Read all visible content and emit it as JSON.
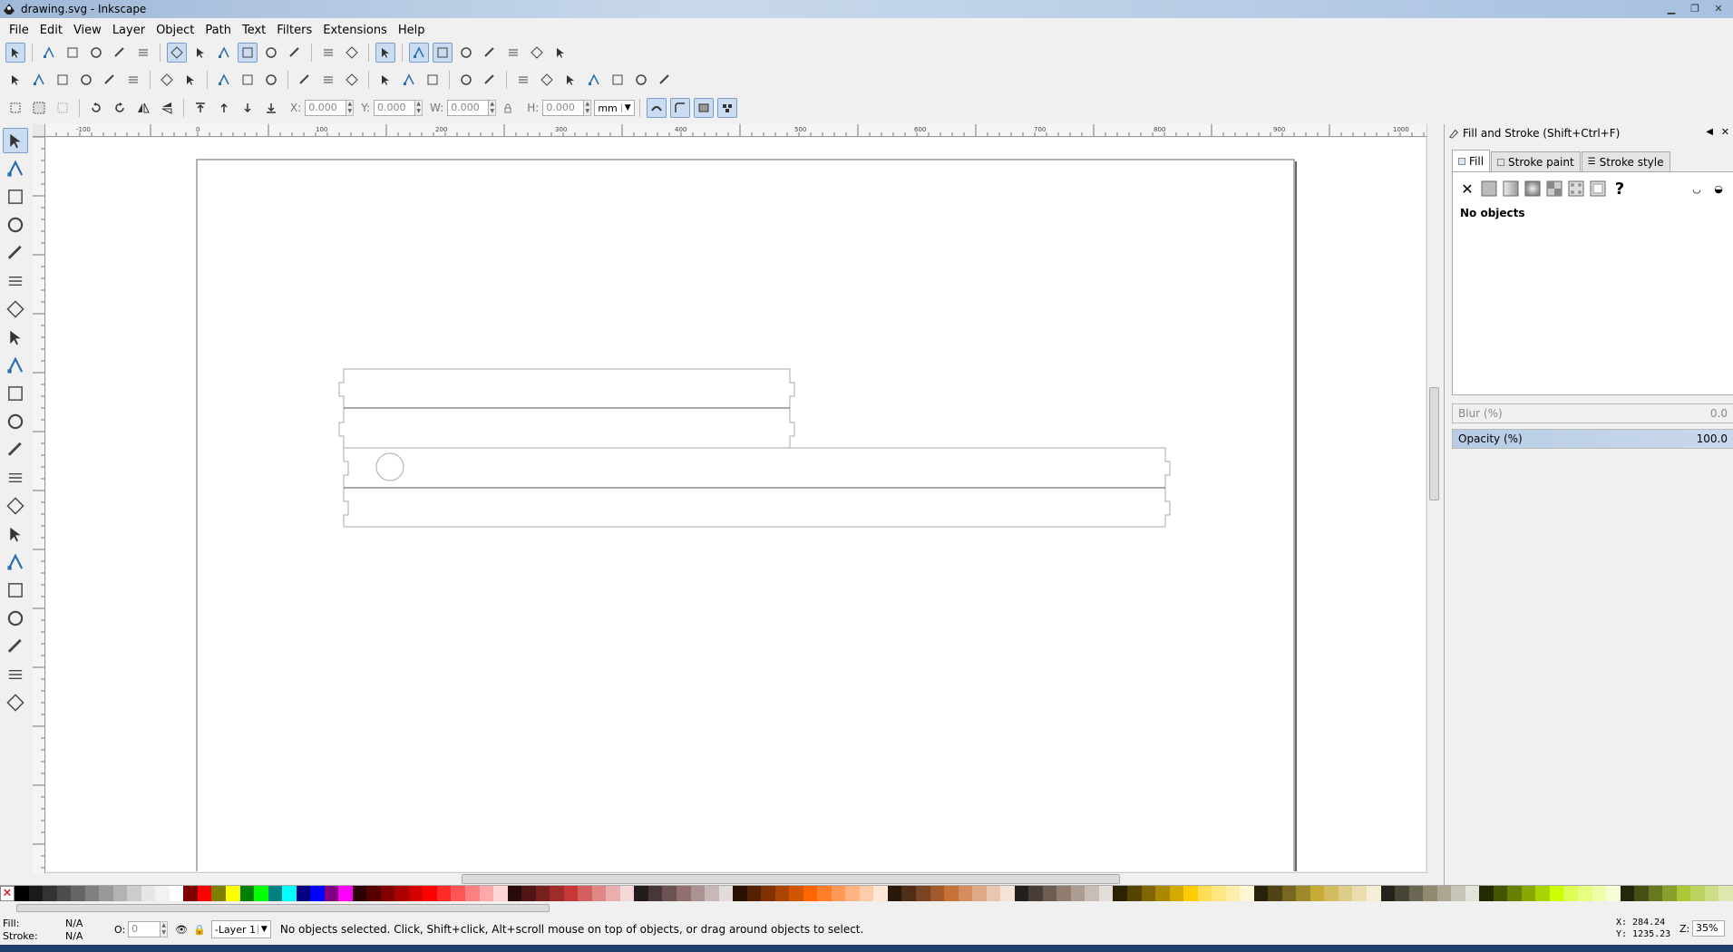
{
  "window": {
    "title": "drawing.svg - Inkscape"
  },
  "menu": [
    "File",
    "Edit",
    "View",
    "Layer",
    "Object",
    "Path",
    "Text",
    "Filters",
    "Extensions",
    "Help"
  ],
  "node_toolbar": {
    "icons": [
      "node-edit-icon",
      "add-node-icon",
      "delete-node-icon",
      "join-nodes-icon",
      "break-path-icon",
      "join-segment-icon",
      "delete-segment-icon",
      "make-cusp-icon",
      "make-smooth-icon",
      "make-symmetric-icon",
      "auto-smooth-icon",
      "line-segment-icon",
      "curve-segment-icon",
      "show-handles-icon",
      "show-outline-icon",
      "snap-nodes-icon",
      "snap-midpoints-icon",
      "snap-center-icon",
      "text-snap-icon",
      "page-snap-icon",
      "grid-snap-icon",
      "guide-snap-icon"
    ]
  },
  "command_bar": {
    "icons": [
      "new-icon",
      "open-icon",
      "save-icon",
      "print-icon",
      "import-icon",
      "export-icon",
      "undo-icon",
      "redo-icon",
      "copy-icon",
      "cut-icon",
      "paste-icon",
      "zoom-drawing-icon",
      "zoom-page-icon",
      "zoom-width-icon",
      "duplicate-icon",
      "clone-icon",
      "unlink-clone-icon",
      "group-icon",
      "ungroup-icon",
      "fill-stroke-icon",
      "text-font-icon",
      "layers-icon",
      "xml-editor-icon",
      "align-icon",
      "preferences-icon",
      "document-props-icon"
    ]
  },
  "tool_controls": {
    "x_label": "X:",
    "x_value": "0.000",
    "y_label": "Y:",
    "y_value": "0.000",
    "w_label": "W:",
    "w_value": "0.000",
    "h_label": "H:",
    "h_value": "0.000",
    "unit": "mm"
  },
  "toolbox": [
    "selector-tool-icon",
    "node-tool-icon",
    "tweak-tool-icon",
    "zoom-tool-icon",
    "measure-tool-icon",
    "rect-tool-icon",
    "3dbox-tool-icon",
    "ellipse-tool-icon",
    "star-tool-icon",
    "spiral-tool-icon",
    "pencil-tool-icon",
    "pen-tool-icon",
    "calligraphy-tool-icon",
    "text-tool-icon",
    "spray-tool-icon",
    "eraser-tool-icon",
    "bucket-tool-icon",
    "gradient-tool-icon",
    "mesh-tool-icon",
    "dropper-tool-icon",
    "connector-tool-icon"
  ],
  "ruler": {
    "h_labels": [
      "-100",
      "0",
      "100",
      "200",
      "300",
      "400",
      "500",
      "600",
      "700",
      "800",
      "900",
      "1000",
      "1100"
    ]
  },
  "dock": {
    "title": "Fill and Stroke (Shift+Ctrl+F)",
    "tabs": [
      "Fill",
      "Stroke paint",
      "Stroke style"
    ],
    "paint_buttons": [
      "no-paint-icon",
      "flat-color-icon",
      "linear-gradient-icon",
      "radial-gradient-icon",
      "mesh-gradient-icon",
      "pattern-icon",
      "swatch-icon",
      "unset-paint-icon"
    ],
    "status": "No objects",
    "blur_label": "Blur (%)",
    "blur_value": "0.0",
    "opacity_label": "Opacity (%)",
    "opacity_value": "100.0"
  },
  "palette": {
    "colors": [
      "#000000",
      "#1a1a1a",
      "#333333",
      "#4d4d4d",
      "#666666",
      "#808080",
      "#999999",
      "#b3b3b3",
      "#cccccc",
      "#e6e6e6",
      "#f2f2f2",
      "#ffffff",
      "#800000",
      "#ff0000",
      "#808000",
      "#ffff00",
      "#008000",
      "#00ff00",
      "#008080",
      "#00ffff",
      "#000080",
      "#0000ff",
      "#800080",
      "#ff00ff",
      "#2b0000",
      "#550000",
      "#800000",
      "#aa0000",
      "#d40000",
      "#ff0000",
      "#ff2a2a",
      "#ff5555",
      "#ff8080",
      "#ffaaaa",
      "#ffd5d5",
      "#280b0b",
      "#501616",
      "#782121",
      "#a02c2c",
      "#c83737",
      "#d35f5f",
      "#de8787",
      "#e9afaf",
      "#f4d7d7",
      "#241c1c",
      "#483737",
      "#6c5353",
      "#916f6f",
      "#ac9393",
      "#c8b7b7",
      "#e3dbdb",
      "#2b1100",
      "#552200",
      "#803300",
      "#aa4400",
      "#d45500",
      "#ff6600",
      "#ff7f2a",
      "#ff9955",
      "#ffb380",
      "#ffccaa",
      "#ffe6d5",
      "#28170b",
      "#502d16",
      "#784421",
      "#a05a2c",
      "#c87137",
      "#d38d5f",
      "#deaa87",
      "#e9c6af",
      "#f4e3d7",
      "#241f1c",
      "#483e37",
      "#6c5d53",
      "#917c6f",
      "#ac9d93",
      "#c8beb7",
      "#e3dedb",
      "#2b2200",
      "#554400",
      "#806600",
      "#aa8800",
      "#d4aa00",
      "#ffcc00",
      "#ffdd55",
      "#ffe680",
      "#ffeeaa",
      "#fff6d5",
      "#28220b",
      "#504416",
      "#786721",
      "#a0892c",
      "#c8ab37",
      "#d3bc5f",
      "#decd87",
      "#e9ddaf",
      "#f4eed7",
      "#24221c",
      "#484537",
      "#6c6753",
      "#918a6f",
      "#aca793",
      "#c8c4b7",
      "#e3e2db",
      "#222b00",
      "#445500",
      "#668000",
      "#88aa00",
      "#aad400",
      "#ccff00",
      "#ddff55",
      "#e5ff80",
      "#eeffaa",
      "#f6ffd5",
      "#22280b",
      "#445016",
      "#677821",
      "#89a02c",
      "#abc837",
      "#bcd35f",
      "#cdde87",
      "#dde9af"
    ]
  },
  "status": {
    "fill_label": "Fill:",
    "fill_value": "N/A",
    "stroke_label": "Stroke:",
    "stroke_value": "N/A",
    "opacity_label": "O:",
    "opacity_value": "0",
    "layer": "-Layer 1",
    "message": "No objects selected. Click, Shift+click, Alt+scroll mouse on top of objects, or drag around objects to select.",
    "cursor_x": "X: 284.24",
    "cursor_y": "Y: 1235.23",
    "zoom_label": "Z:",
    "zoom_value": "35%"
  }
}
